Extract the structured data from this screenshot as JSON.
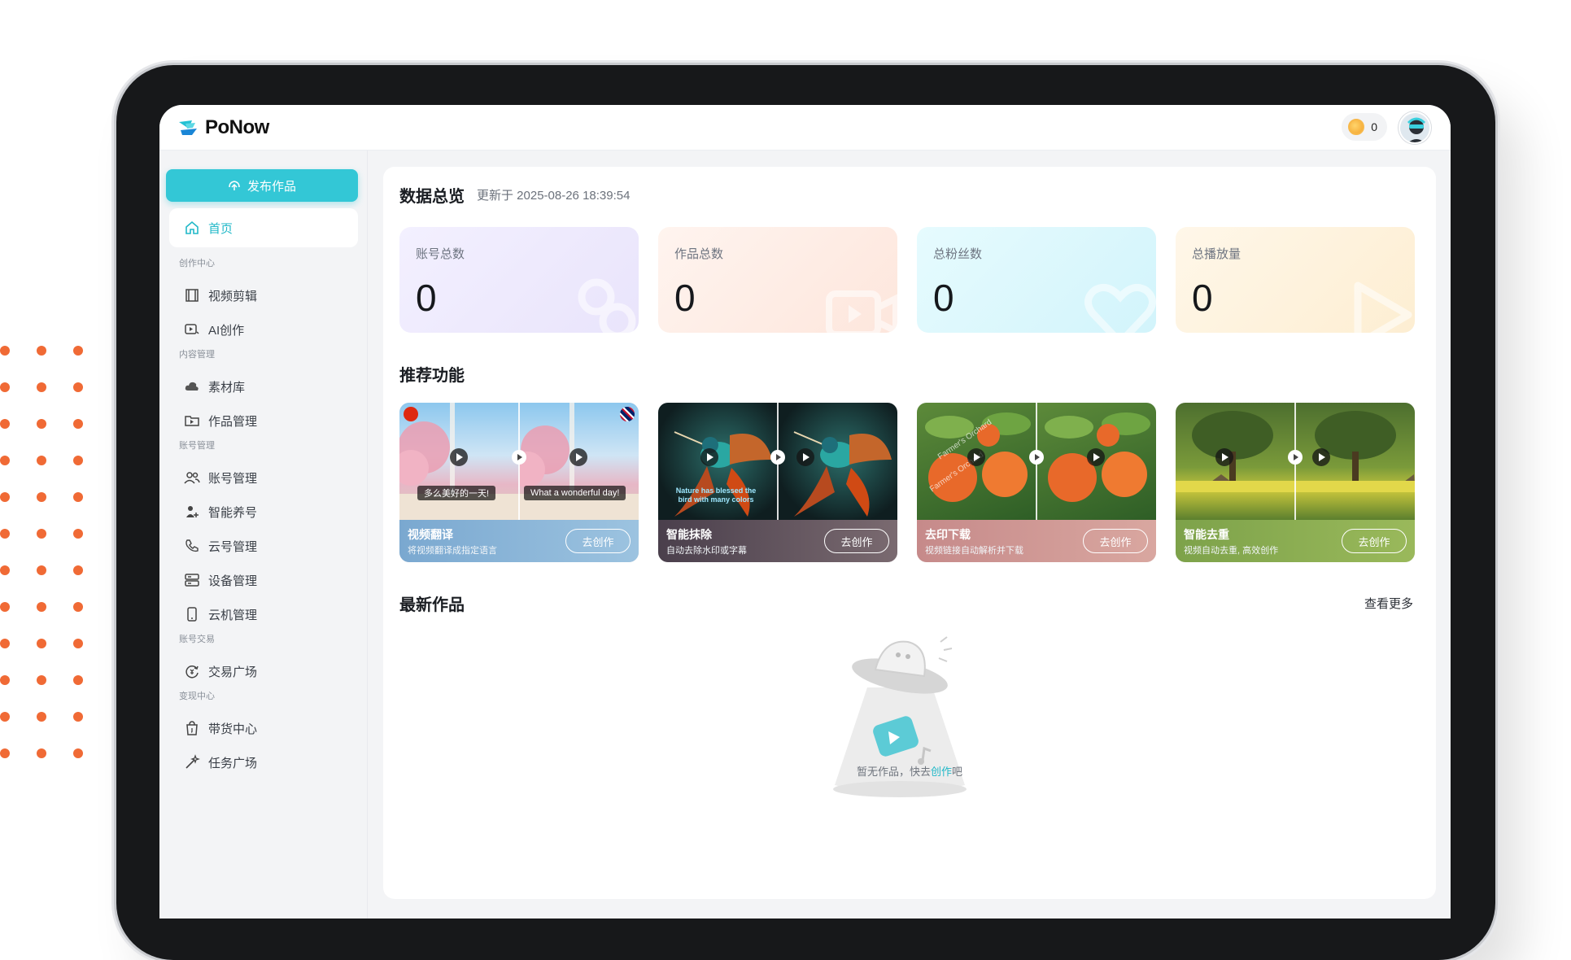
{
  "app": {
    "name": "PoNow"
  },
  "header": {
    "coins": "0"
  },
  "sidebar": {
    "publish_label": "发布作品",
    "home_label": "首页",
    "sections": [
      {
        "title": "创作中心",
        "items": [
          "视频剪辑",
          "AI创作"
        ]
      },
      {
        "title": "内容管理",
        "items": [
          "素材库",
          "作品管理"
        ]
      },
      {
        "title": "账号管理",
        "items": [
          "账号管理",
          "智能养号",
          "云号管理",
          "设备管理",
          "云机管理"
        ]
      },
      {
        "title": "账号交易",
        "items": [
          "交易广场"
        ]
      },
      {
        "title": "变现中心",
        "items": [
          "带货中心",
          "任务广场"
        ]
      }
    ]
  },
  "overview": {
    "title": "数据总览",
    "updated": "更新于 2025-08-26 18:39:54",
    "stats": [
      {
        "label": "账号总数",
        "value": "0"
      },
      {
        "label": "作品总数",
        "value": "0"
      },
      {
        "label": "总粉丝数",
        "value": "0"
      },
      {
        "label": "总播放量",
        "value": "0"
      }
    ]
  },
  "recommend": {
    "title": "推荐功能",
    "cards": [
      {
        "title": "视频翻译",
        "desc": "将视频翻译成指定语言",
        "button": "去创作",
        "caption_left": "多么美好的一天!",
        "caption_right": "What a wonderful day!"
      },
      {
        "title": "智能抹除",
        "desc": "自动去除水印或字幕",
        "button": "去创作",
        "caption_left": "Nature has blessed the bird with many colors"
      },
      {
        "title": "去印下载",
        "desc": "视频链接自动解析并下载",
        "button": "去创作",
        "watermark": "Farmer's Orchard"
      },
      {
        "title": "智能去重",
        "desc": "视频自动去重, 高效创作",
        "button": "去创作"
      }
    ]
  },
  "latest": {
    "title": "最新作品",
    "see_more": "查看更多",
    "empty_prefix": "暂无作品，快去",
    "empty_link": "创作",
    "empty_suffix": "吧"
  },
  "colors": {
    "accent": "#33c7d6",
    "decor_dots": "#f06a35"
  }
}
